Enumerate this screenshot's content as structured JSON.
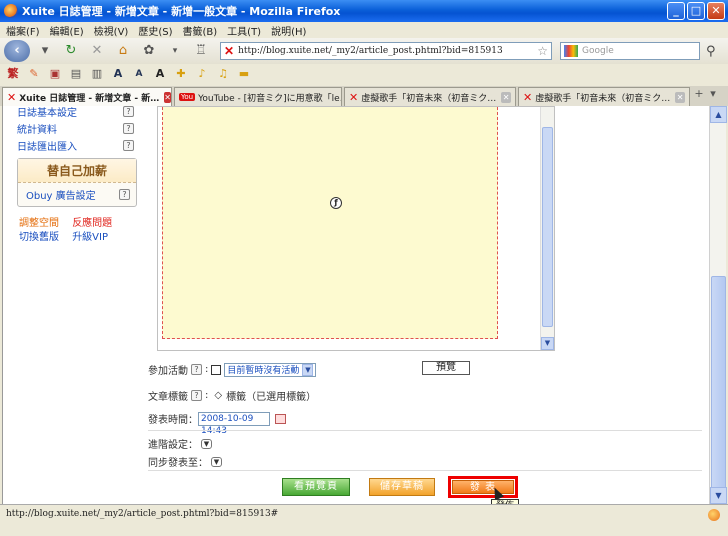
{
  "window": {
    "title": "Xuite 日誌管理 - 新增文章 - 新增一般文章 - Mozilla Firefox"
  },
  "menu": [
    "檔案(F)",
    "編輯(E)",
    "檢視(V)",
    "歷史(S)",
    "書籤(B)",
    "工具(T)",
    "說明(H)"
  ],
  "nav": {
    "url": "http://blog.xuite.net/_my2/article_post.phtml?bid=815913",
    "search_placeholder": "Google"
  },
  "toolbar2": [
    "繁",
    "A",
    "A",
    "A"
  ],
  "tabs": [
    {
      "label": "Xuite 日誌管理 - 新增文章 - 新…",
      "active": true
    },
    {
      "label": "YouTube - [初音ミク]に用意歌「le…",
      "active": false
    },
    {
      "label": "虛擬歌手「初音未來（初音ミク…",
      "active": false
    },
    {
      "label": "虛擬歌手「初音未來（初音ミク…",
      "active": false
    }
  ],
  "sidebar": {
    "items": [
      "日誌基本設定",
      "統計資料",
      "日誌匯出匯入"
    ],
    "box_title": "替自己加薪",
    "box_item": "Obuy 廣告設定",
    "links": {
      "adjust_space": "調整空間",
      "report_issue": "反應問題",
      "switch_old": "切換舊版",
      "upgrade_vip": "升級VIP"
    }
  },
  "form": {
    "activity_label": "參加活動",
    "activity_select": "目前暫時沒有活動",
    "preview_label": "預覽",
    "tags_label": "文章標籤",
    "tags_value": "標籤（已選用標籤）",
    "time_label": "發表時間：",
    "time_value": "2008-10-09 14:43",
    "advanced_label": "進階設定：",
    "sync_label": "同步發表至："
  },
  "actions": {
    "view_page": "看預覽頁",
    "save_draft": "儲存草稿",
    "publish": "發 表"
  },
  "tooltip": "發佈",
  "status": {
    "url": "http://blog.xuite.net/_my2/article_post.phtml?bid=815913#"
  }
}
